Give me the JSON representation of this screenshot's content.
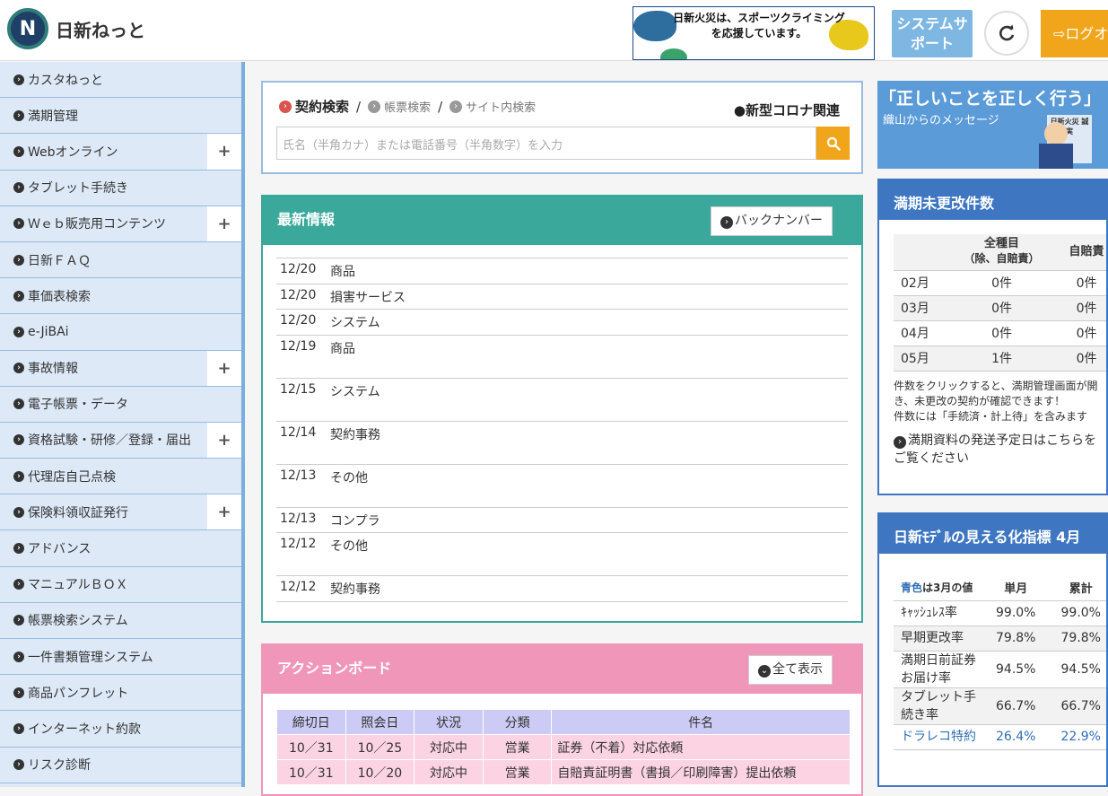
{
  "header": {
    "brand": "日新ねっと",
    "logo_letter": "N",
    "banner_text": "日新火災は、スポーツクライミングを応援しています。",
    "system_support": "システムサポート",
    "logout": "ログオ",
    "accent": "#f0a51a"
  },
  "sidebar": {
    "items": [
      {
        "label": "カスタねっと",
        "plus": false
      },
      {
        "label": "満期管理",
        "plus": false
      },
      {
        "label": "Webオンライン",
        "plus": true
      },
      {
        "label": "タブレット手続き",
        "plus": false
      },
      {
        "label": "Ｗｅｂ販売用コンテンツ",
        "plus": true
      },
      {
        "label": "日新ＦＡＱ",
        "plus": false
      },
      {
        "label": "車価表検索",
        "plus": false
      },
      {
        "label": "e-JiBAi",
        "plus": false
      },
      {
        "label": "事故情報",
        "plus": true
      },
      {
        "label": "電子帳票・データ",
        "plus": false
      },
      {
        "label": "資格試験・研修／登録・届出",
        "plus": true
      },
      {
        "label": "代理店自己点検",
        "plus": false
      },
      {
        "label": "保険料領収証発行",
        "plus": true
      },
      {
        "label": "アドバンス",
        "plus": false
      },
      {
        "label": "マニュアルＢＯＸ",
        "plus": false
      },
      {
        "label": "帳票検索システム",
        "plus": false
      },
      {
        "label": "一件書類管理システム",
        "plus": false
      },
      {
        "label": "商品パンフレット",
        "plus": false
      },
      {
        "label": "インターネット約款",
        "plus": false
      },
      {
        "label": "リスク診断",
        "plus": false
      }
    ]
  },
  "search": {
    "tab_active": "契約検索",
    "tab_2": "帳票検索",
    "tab_3": "サイト内検索",
    "separator": "/",
    "corona": "●新型コロナ関連",
    "placeholder": "氏名（半角カナ）または電話番号（半角数字）を入力"
  },
  "news": {
    "title": "最新情報",
    "back_number": "バックナンバー",
    "items": [
      {
        "date": "12/20",
        "category": "商品",
        "tall": false
      },
      {
        "date": "12/20",
        "category": "損害サービス",
        "tall": false
      },
      {
        "date": "12/20",
        "category": "システム",
        "tall": false
      },
      {
        "date": "12/19",
        "category": "商品",
        "tall": true
      },
      {
        "date": "12/15",
        "category": "システム",
        "tall": true
      },
      {
        "date": "12/14",
        "category": "契約事務",
        "tall": true
      },
      {
        "date": "12/13",
        "category": "その他",
        "tall": true
      },
      {
        "date": "12/13",
        "category": "コンプラ",
        "tall": false
      },
      {
        "date": "12/12",
        "category": "その他",
        "tall": true
      },
      {
        "date": "12/12",
        "category": "契約事務",
        "tall": false
      }
    ]
  },
  "action_board": {
    "title": "アクションボード",
    "show_all": "全て表示",
    "headers": [
      "締切日",
      "照会日",
      "状況",
      "分類",
      "件名"
    ],
    "rows": [
      [
        "10／31",
        "10／25",
        "対応中",
        "営業",
        "証券（不着）対応依頼"
      ],
      [
        "10／31",
        "10／20",
        "対応中",
        "営業",
        "自賠責証明書（書損／印刷障害）提出依頼"
      ]
    ]
  },
  "right_banner": {
    "title": "「正しいことを正しく行う」",
    "subtitle": "織山からのメッセージ",
    "sign": "日新火災 誠実"
  },
  "maturity": {
    "title": "満期未更改件数",
    "header_all": "全種目",
    "header_all_sub": "（除、自賠責）",
    "header_jibai": "自賠責",
    "rows": [
      [
        "02月",
        "0件",
        "0件"
      ],
      [
        "03月",
        "0件",
        "0件"
      ],
      [
        "04月",
        "0件",
        "0件"
      ],
      [
        "05月",
        "1件",
        "0件"
      ]
    ],
    "note1": "件数をクリックすると、満期管理画面が開き、未更改の契約が確認できます！",
    "note2": "件数には「手続済・計上待」を含みます",
    "link": "満期資料の発送予定日はこちらをご覧ください"
  },
  "kpi": {
    "title": "日新ﾓﾃﾞﾙの見える化指標 4月",
    "head_blue": "青色",
    "head_rest": "は3月の値",
    "col_month": "単月",
    "col_total": "累計",
    "rows": [
      {
        "label": "ｷｬｯｼｭﾚｽ率",
        "month": "99.0%",
        "total": "99.0%",
        "blue": false
      },
      {
        "label": "早期更改率",
        "month": "79.8%",
        "total": "79.8%",
        "blue": false
      },
      {
        "label": "満期日前証券お届け率",
        "month": "94.5%",
        "total": "94.5%",
        "blue": false
      },
      {
        "label": "タブレット手続き率",
        "month": "66.7%",
        "total": "66.7%",
        "blue": false
      },
      {
        "label": "ドラレコ特約",
        "month": "26.4%",
        "total": "22.9%",
        "blue": true
      }
    ]
  }
}
